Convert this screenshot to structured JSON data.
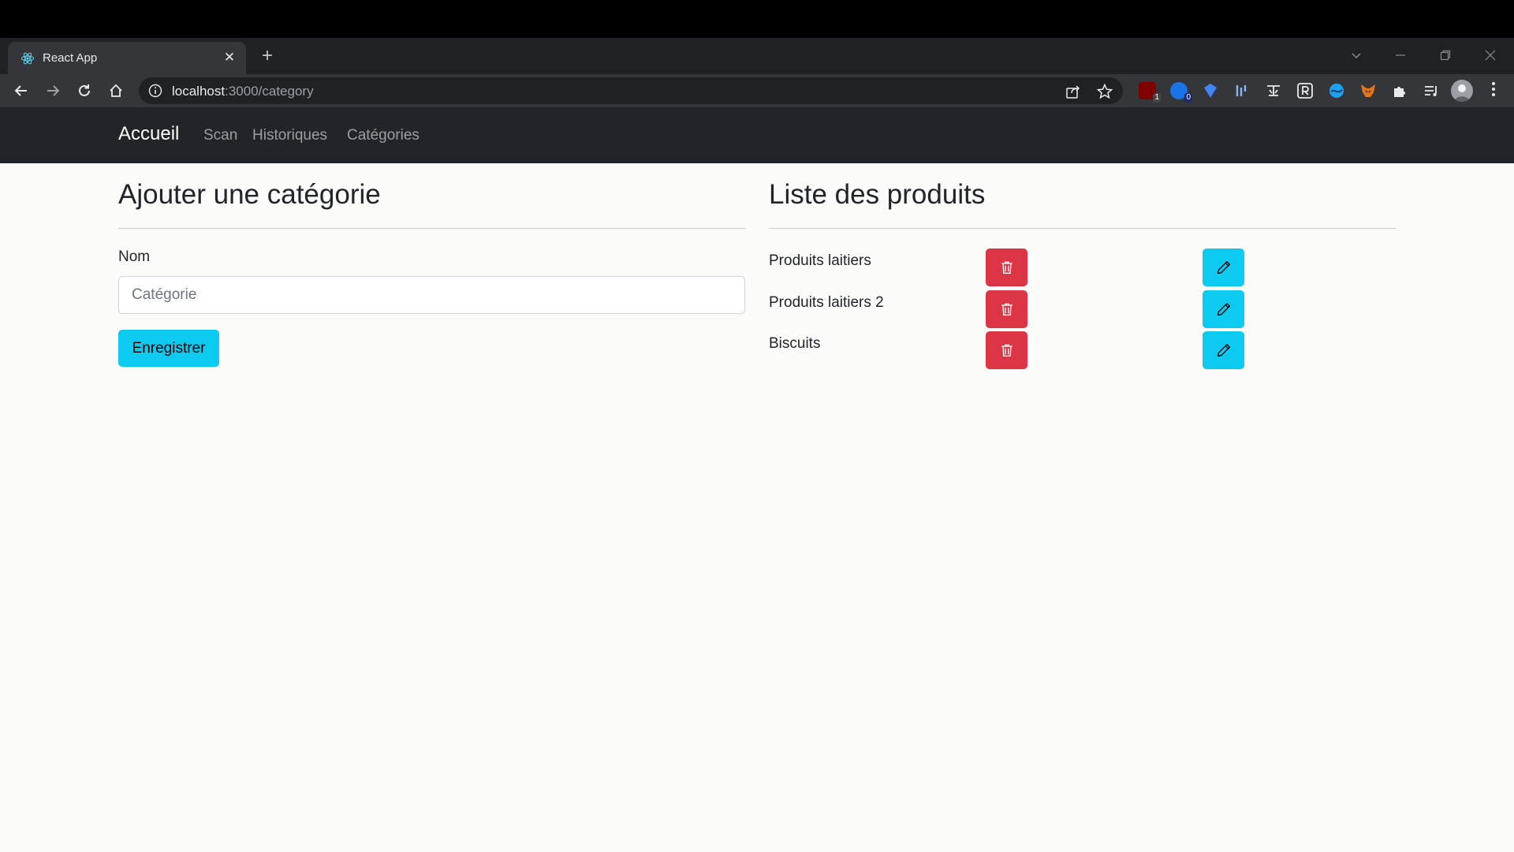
{
  "browser": {
    "tab_title": "React App",
    "close_glyph": "✕",
    "new_tab_glyph": "+",
    "url_host": "localhost",
    "url_rest": ":3000/category",
    "extension_badges": [
      "1",
      "0"
    ]
  },
  "navbar": {
    "brand": "Accueil",
    "links": [
      "Scan",
      "Historiques",
      "Catégories"
    ]
  },
  "form": {
    "heading": "Ajouter une catégorie",
    "label": "Nom",
    "placeholder": "Catégorie",
    "value": "",
    "submit": "Enregistrer"
  },
  "list": {
    "heading": "Liste des produits",
    "items": [
      "Produits laitiers",
      "Produits laitiers 2",
      "Biscuits"
    ]
  },
  "colors": {
    "danger": "#dc3545",
    "info": "#0dcaf0",
    "navbar": "#212529"
  }
}
